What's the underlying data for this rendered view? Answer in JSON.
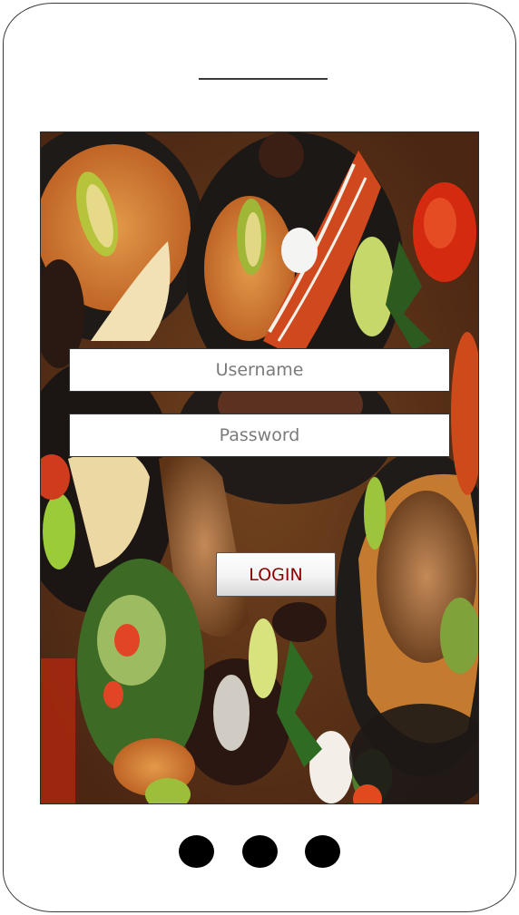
{
  "login_form": {
    "username_placeholder": "Username",
    "password_placeholder": "Password",
    "login_label": "LOGIN"
  },
  "colors": {
    "login_text": "#8b0000",
    "placeholder_text": "#7a7a7a"
  },
  "icons": [
    "nav-dot-icon"
  ]
}
